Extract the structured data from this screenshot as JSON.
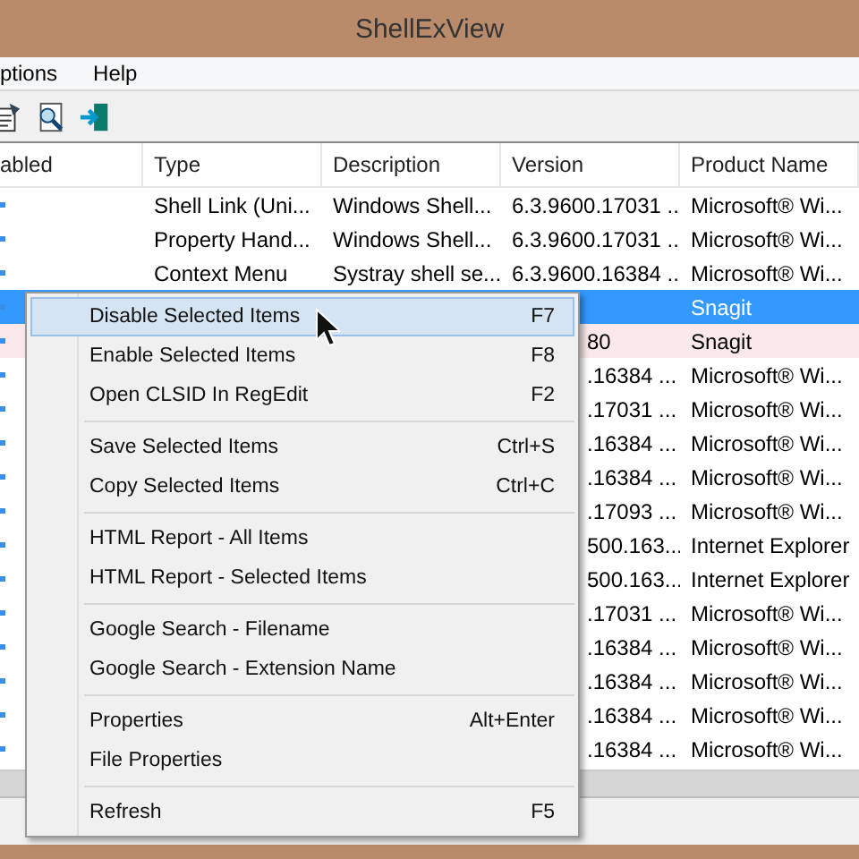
{
  "window": {
    "title": "ShellExView"
  },
  "menu_bar": [
    "ptions",
    "Help"
  ],
  "table": {
    "columns": [
      "abled",
      "Type",
      "Description",
      "Version",
      "Product Name"
    ],
    "rows": [
      {
        "type": "Shell Link (Uni...",
        "description": "Windows Shell...",
        "version": "6.3.9600.17031 ...",
        "product": "Microsoft® Wi...",
        "selected": false,
        "disabled": false
      },
      {
        "type": "Property Hand...",
        "description": "Windows Shell...",
        "version": "6.3.9600.17031 ...",
        "product": "Microsoft® Wi...",
        "selected": false,
        "disabled": false
      },
      {
        "type": "Context Menu",
        "description": "Systray shell se...",
        "version": "6.3.9600.16384 ...",
        "product": "Microsoft® Wi...",
        "selected": false,
        "disabled": false
      },
      {
        "product": "Snagit",
        "selected": true,
        "disabled": false
      },
      {
        "version": "80",
        "product": "Snagit",
        "selected": false,
        "disabled": true
      },
      {
        "version": ".16384 ...",
        "product": "Microsoft® Wi...",
        "selected": false,
        "disabled": false
      },
      {
        "version": ".17031 ...",
        "product": "Microsoft® Wi...",
        "selected": false,
        "disabled": false
      },
      {
        "version": ".16384 ...",
        "product": "Microsoft® Wi...",
        "selected": false,
        "disabled": false
      },
      {
        "version": ".16384 ...",
        "product": "Microsoft® Wi...",
        "selected": false,
        "disabled": false
      },
      {
        "version": ".17093 ...",
        "product": "Microsoft® Wi...",
        "selected": false,
        "disabled": false
      },
      {
        "version": "500.163...",
        "product": "Internet Explorer",
        "selected": false,
        "disabled": false
      },
      {
        "version": "500.163...",
        "product": "Internet Explorer",
        "selected": false,
        "disabled": false
      },
      {
        "version": ".17031 ...",
        "product": "Microsoft® Wi...",
        "selected": false,
        "disabled": false
      },
      {
        "version": ".16384 ...",
        "product": "Microsoft® Wi...",
        "selected": false,
        "disabled": false
      },
      {
        "version": ".16384 ...",
        "product": "Microsoft® Wi...",
        "selected": false,
        "disabled": false
      },
      {
        "version": ".16384 ...",
        "product": "Microsoft® Wi...",
        "selected": false,
        "disabled": false
      },
      {
        "version": ".16384 ...",
        "product": "Microsoft® Wi...",
        "selected": false,
        "disabled": false
      }
    ]
  },
  "context_menu": [
    {
      "kind": "item",
      "label": "Disable Selected Items",
      "shortcut": "F7",
      "selected": true
    },
    {
      "kind": "item",
      "label": "Enable Selected Items",
      "shortcut": "F8",
      "selected": false
    },
    {
      "kind": "item",
      "label": "Open CLSID In RegEdit",
      "shortcut": "F2",
      "selected": false
    },
    {
      "kind": "separator"
    },
    {
      "kind": "item",
      "label": "Save Selected Items",
      "shortcut": "Ctrl+S",
      "selected": false
    },
    {
      "kind": "item",
      "label": "Copy Selected Items",
      "shortcut": "Ctrl+C",
      "selected": false
    },
    {
      "kind": "separator"
    },
    {
      "kind": "item",
      "label": "HTML Report - All Items",
      "selected": false
    },
    {
      "kind": "item",
      "label": "HTML Report - Selected Items",
      "selected": false
    },
    {
      "kind": "separator"
    },
    {
      "kind": "item",
      "label": "Google Search - Filename",
      "selected": false
    },
    {
      "kind": "item",
      "label": "Google Search - Extension Name",
      "selected": false
    },
    {
      "kind": "separator"
    },
    {
      "kind": "item",
      "label": "Properties",
      "shortcut": "Alt+Enter",
      "selected": false
    },
    {
      "kind": "item",
      "label": "File Properties",
      "selected": false
    },
    {
      "kind": "separator"
    },
    {
      "kind": "item",
      "label": "Refresh",
      "shortcut": "F5",
      "selected": false
    }
  ]
}
